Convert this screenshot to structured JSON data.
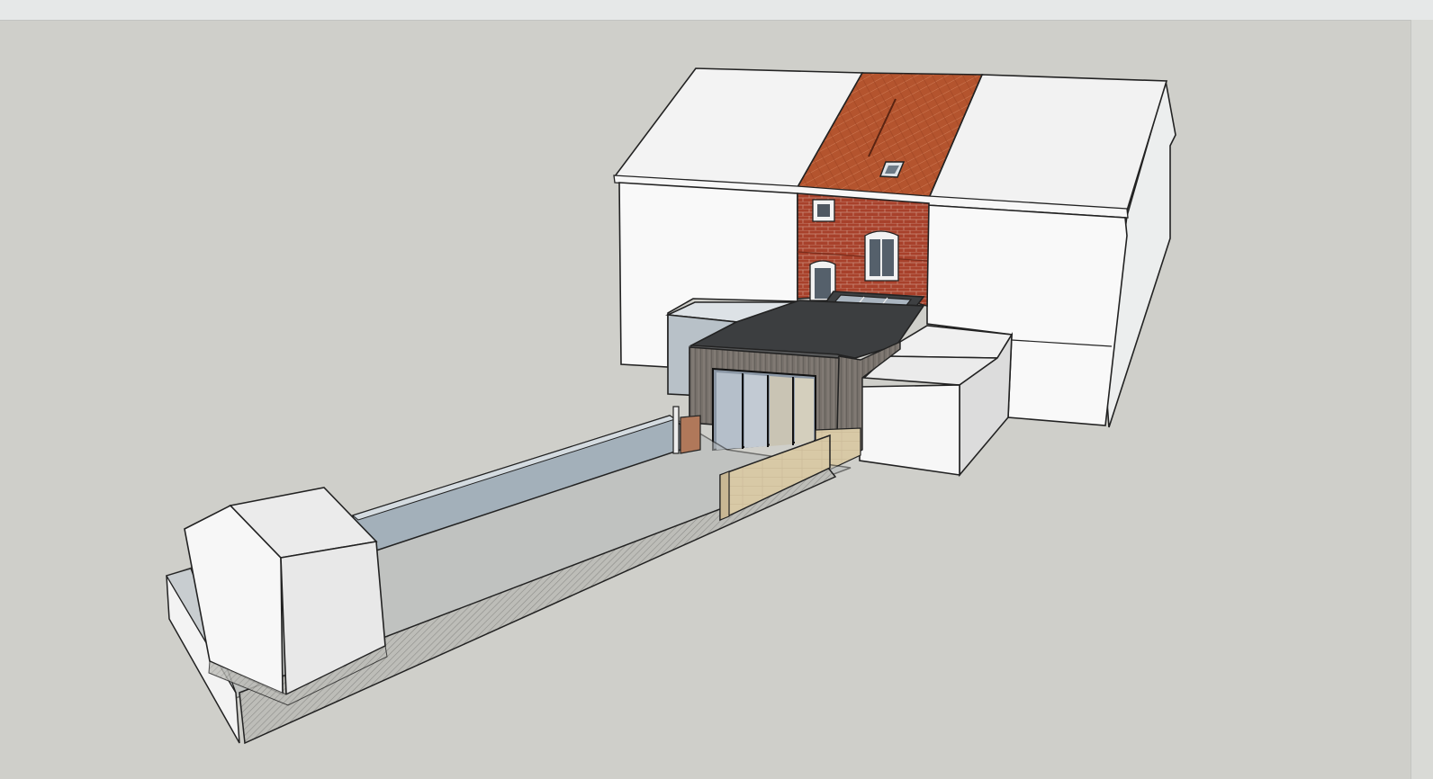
{
  "app": {
    "window_title": "",
    "view": "3d-model-viewport"
  },
  "scene": {
    "background_color": "#cfcfca",
    "colors": {
      "roof_red": "#b4542e",
      "brick": "#a8412b",
      "white": "#f8f8f8",
      "glass": "#aab4c0",
      "dark_roof": "#3e4042",
      "wood_cladding": "#76706a",
      "sandstone": "#d8c9a6",
      "grey_wall": "#9fabb3"
    }
  }
}
